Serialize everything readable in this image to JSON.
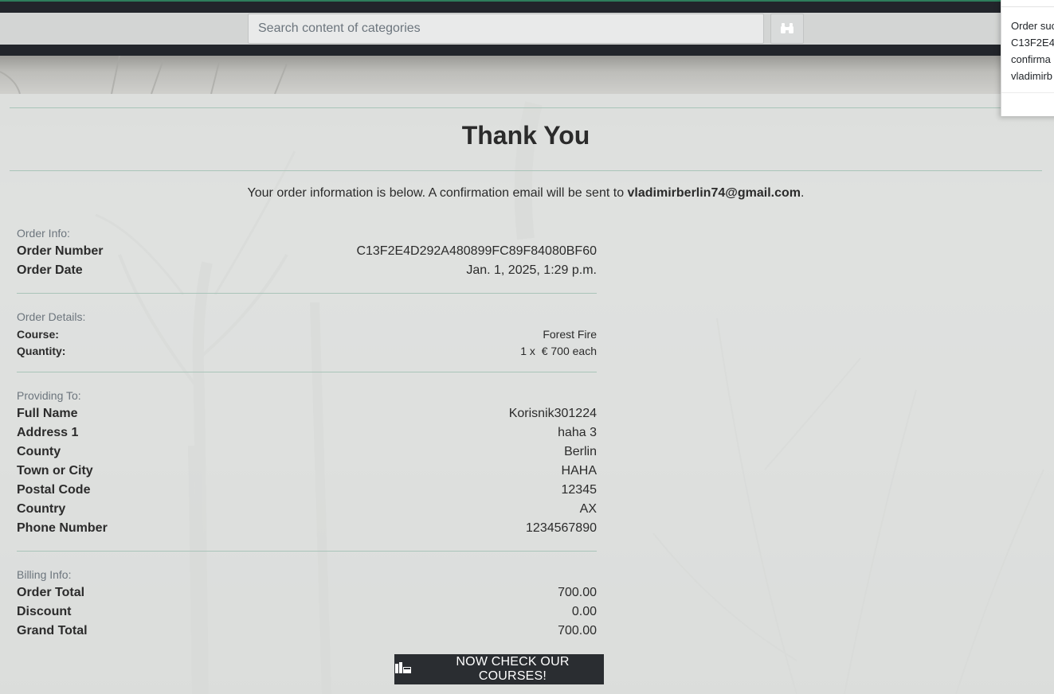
{
  "search": {
    "placeholder": "Search content of categories"
  },
  "page": {
    "title": "Thank You",
    "intro_prefix": "Your order information is below. A confirmation email will be sent to ",
    "intro_email": "vladimirberlin74@gmail.com",
    "intro_suffix": "."
  },
  "order_info": {
    "label": "Order Info:",
    "rows": [
      {
        "key": "Order Number",
        "value": "C13F2E4D292A480899FC89F84080BF60"
      },
      {
        "key": "Order Date",
        "value": "Jan. 1, 2025, 1:29 p.m."
      }
    ]
  },
  "order_details": {
    "label": "Order Details:",
    "rows": [
      {
        "key": "Course:",
        "value": "Forest Fire"
      },
      {
        "key": "Quantity:",
        "value": "1 x  € 700 each"
      }
    ]
  },
  "providing_to": {
    "label": "Providing To:",
    "rows": [
      {
        "key": "Full Name",
        "value": "Korisnik301224"
      },
      {
        "key": "Address 1",
        "value": "haha 3"
      },
      {
        "key": "County",
        "value": "Berlin"
      },
      {
        "key": "Town or City",
        "value": "HAHA"
      },
      {
        "key": "Postal Code",
        "value": "12345"
      },
      {
        "key": "Country",
        "value": "AX"
      },
      {
        "key": "Phone Number",
        "value": "1234567890"
      }
    ]
  },
  "billing_info": {
    "label": "Billing Info:",
    "rows": [
      {
        "key": "Order Total",
        "value": "700.00"
      },
      {
        "key": "Discount",
        "value": "0.00"
      },
      {
        "key": "Grand Total",
        "value": "700.00"
      }
    ]
  },
  "cta": {
    "label": "NOW CHECK OUR COURSES!"
  },
  "toast": {
    "lines": [
      "Order suc",
      "C13F2E4I",
      "confirma",
      "vladimirb"
    ]
  },
  "icons": {
    "search_button": "binoculars-icon",
    "cta": "courses-icon"
  },
  "colors": {
    "top_bar": "#22252b",
    "accent_line": "#2e7d5b",
    "cta_bg": "#2a2d31",
    "divider": "#a9c4b9"
  }
}
